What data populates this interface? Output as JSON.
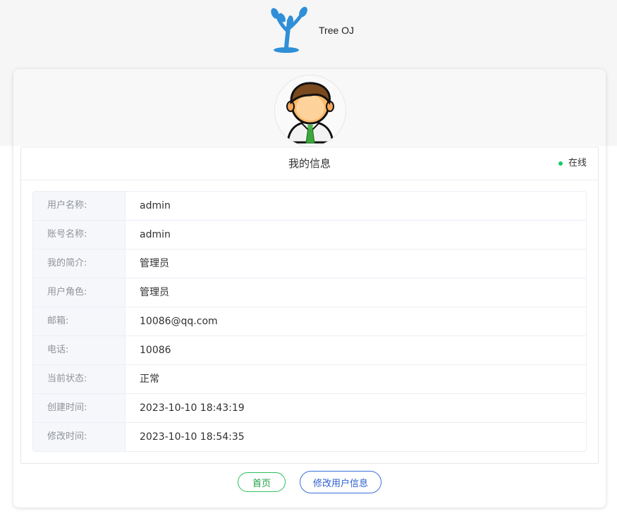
{
  "brand": {
    "name": "Tree OJ",
    "logo_icon": "tree-logo-icon",
    "logo_color": "#2f8fd8"
  },
  "profile": {
    "avatar_icon": "user-avatar-icon"
  },
  "panel": {
    "title": "我的信息",
    "status": {
      "text": "在线",
      "color": "#13ce66"
    }
  },
  "fields": [
    {
      "label": "用户名称:",
      "value": "admin"
    },
    {
      "label": "账号名称:",
      "value": "admin"
    },
    {
      "label": "我的简介:",
      "value": "管理员"
    },
    {
      "label": "用户角色:",
      "value": "管理员"
    },
    {
      "label": "邮箱:",
      "value": "10086@qq.com"
    },
    {
      "label": "电话:",
      "value": "10086"
    },
    {
      "label": "当前状态:",
      "value": "正常"
    },
    {
      "label": "创建时间:",
      "value": "2023-10-10 18:43:19"
    },
    {
      "label": "修改时间:",
      "value": "2023-10-10 18:54:35"
    }
  ],
  "actions": {
    "home_label": "首页",
    "edit_label": "修改用户信息"
  }
}
